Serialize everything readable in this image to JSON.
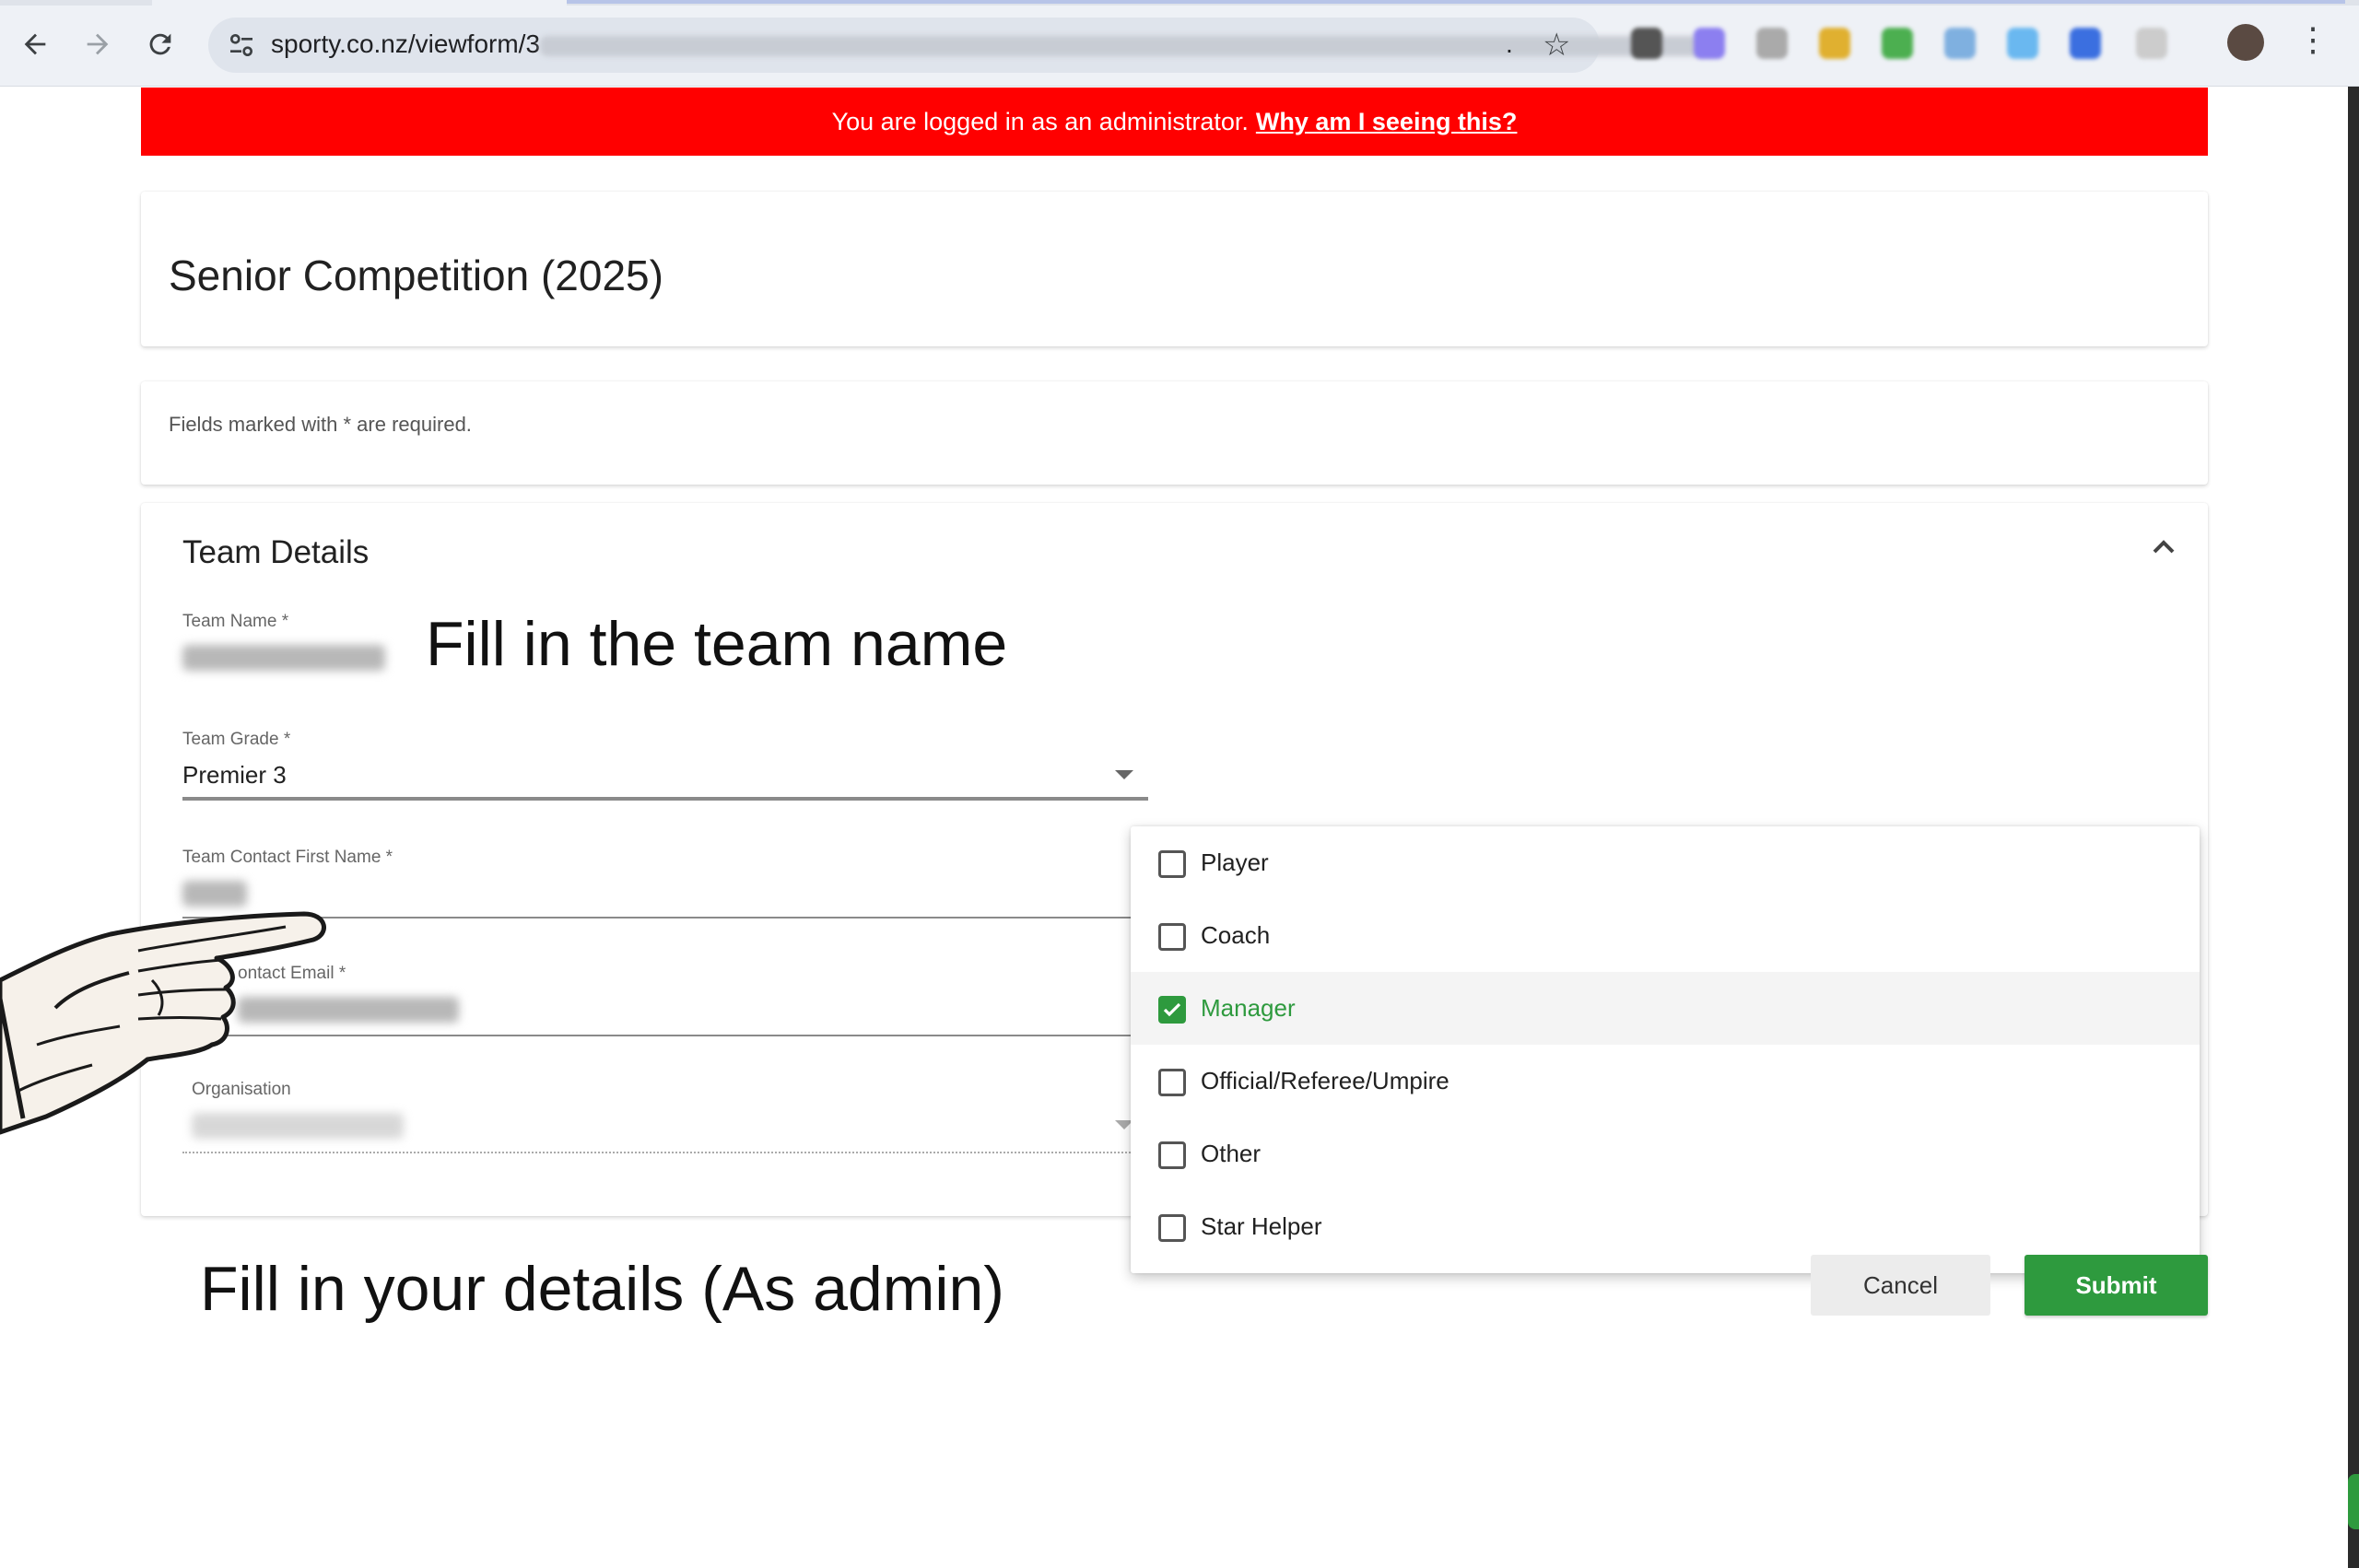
{
  "browser": {
    "url": "sporty.co.nz/viewform/3",
    "url_tail": "."
  },
  "admin_banner": {
    "text": "You are logged in as an administrator.",
    "link": "Why am I seeing this?"
  },
  "form_title": "Senior Competition (2025)",
  "required_note": "Fields marked with * are required.",
  "section": {
    "title": "Team Details",
    "fields": {
      "team_name": {
        "label": "Team Name *"
      },
      "team_grade": {
        "label": "Team Grade *",
        "value": "Premier 3"
      },
      "contact_first_name": {
        "label": "Team Contact First Name *"
      },
      "contact_email": {
        "label": "ontact Email *"
      },
      "organisation": {
        "label": "Organisation"
      }
    }
  },
  "role_menu": {
    "options": [
      {
        "label": "Player",
        "checked": false
      },
      {
        "label": "Coach",
        "checked": false
      },
      {
        "label": "Manager",
        "checked": true
      },
      {
        "label": "Official/Referee/Umpire",
        "checked": false
      },
      {
        "label": "Other",
        "checked": false
      },
      {
        "label": "Star Helper",
        "checked": false
      }
    ]
  },
  "buttons": {
    "cancel": "Cancel",
    "submit": "Submit"
  },
  "annotations": {
    "team_name": "Fill in the team name",
    "details": "Fill in your details (As admin)"
  },
  "colors": {
    "banner": "#ff0000",
    "accent": "#2e9a3e"
  }
}
